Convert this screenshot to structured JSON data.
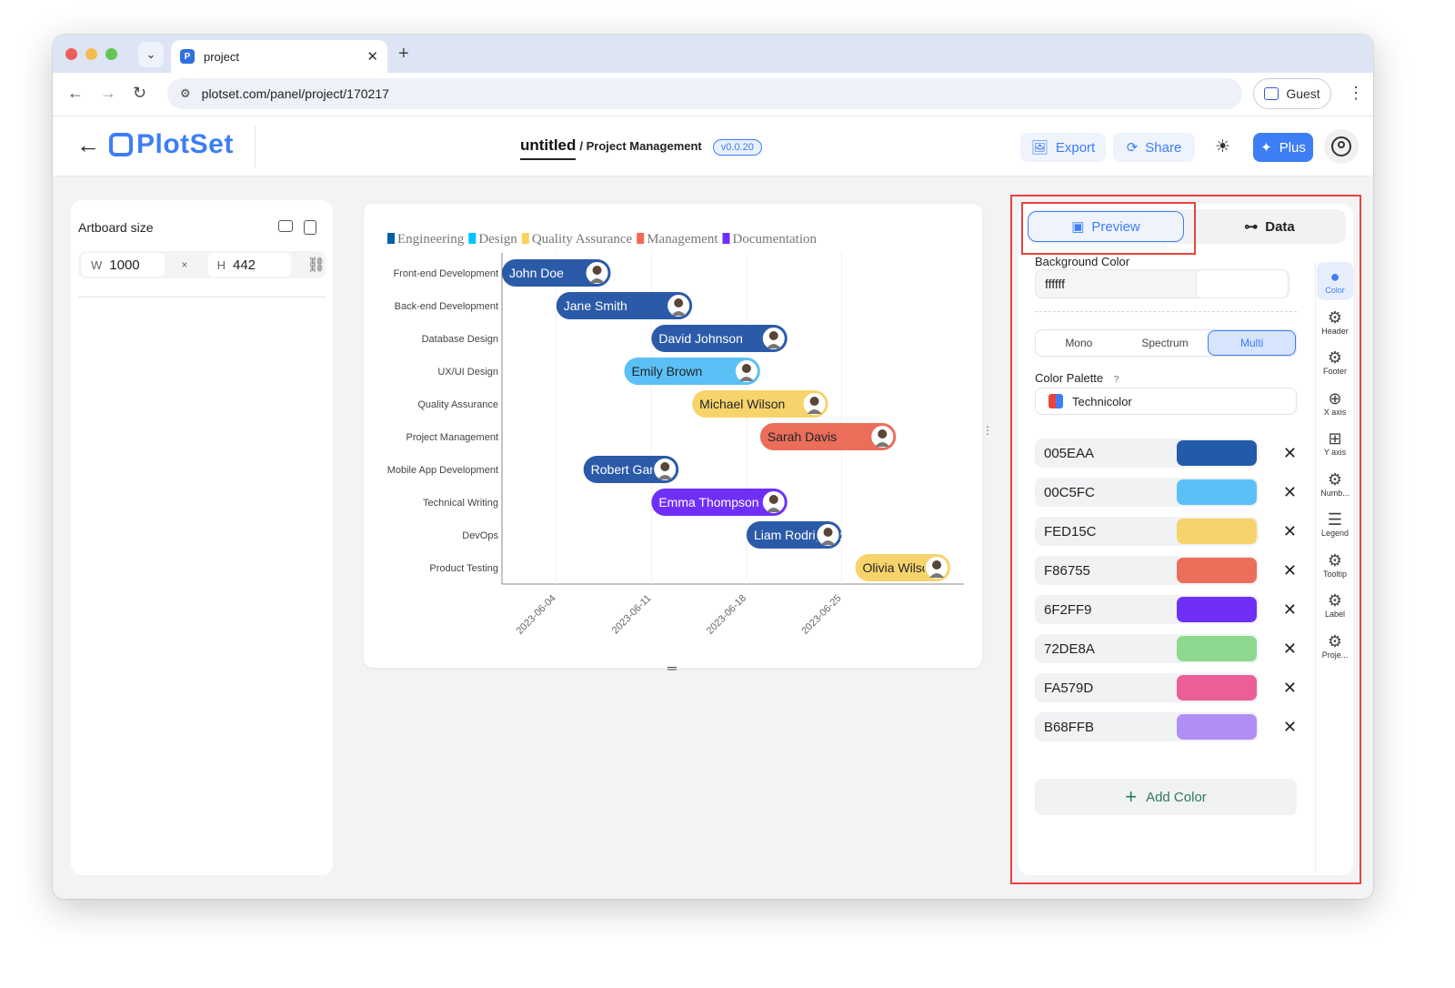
{
  "browser": {
    "tab_title": "project",
    "url": "plotset.com/panel/project/170217",
    "guest_label": "Guest"
  },
  "app": {
    "logo_text": "PlotSet",
    "project_name": "untitled",
    "project_sub": "/ Project Management",
    "version": "v0.0.20",
    "export_label": "Export",
    "share_label": "Share",
    "plus_label": "Plus"
  },
  "artboard": {
    "title": "Artboard size",
    "w_label": "W",
    "w_value": "1000",
    "times": "×",
    "h_label": "H",
    "h_value": "442"
  },
  "chart_data": {
    "type": "gantt",
    "legend": [
      {
        "name": "Engineering",
        "color": "#005EAA"
      },
      {
        "name": "Design",
        "color": "#00C5FC"
      },
      {
        "name": "Quality Assurance",
        "color": "#FED15C"
      },
      {
        "name": "Management",
        "color": "#F86755"
      },
      {
        "name": "Documentation",
        "color": "#6F2FF9"
      }
    ],
    "tasks": [
      {
        "task": "Front-end Development",
        "person": "John Doe",
        "start": "2023-05-31",
        "end": "2023-06-08",
        "color": "#2B5BA8",
        "text": "#ffffff"
      },
      {
        "task": "Back-end Development",
        "person": "Jane Smith",
        "start": "2023-06-04",
        "end": "2023-06-14",
        "color": "#2B5BA8",
        "text": "#ffffff"
      },
      {
        "task": "Database Design",
        "person": "David Johnson",
        "start": "2023-06-11",
        "end": "2023-06-21",
        "color": "#2B5BA8",
        "text": "#ffffff"
      },
      {
        "task": "UX/UI Design",
        "person": "Emily Brown",
        "start": "2023-06-09",
        "end": "2023-06-19",
        "color": "#5BC0F5",
        "text": "#1f2328"
      },
      {
        "task": "Quality Assurance",
        "person": "Michael Wilson",
        "start": "2023-06-14",
        "end": "2023-06-24",
        "color": "#F7D46B",
        "text": "#1f2328"
      },
      {
        "task": "Project Management",
        "person": "Sarah Davis",
        "start": "2023-06-19",
        "end": "2023-06-29",
        "color": "#EA6E5A",
        "text": "#1f2328"
      },
      {
        "task": "Mobile App Development",
        "person": "Robert Garcia",
        "start": "2023-06-06",
        "end": "2023-06-13",
        "color": "#2B5BA8",
        "text": "#ffffff"
      },
      {
        "task": "Technical Writing",
        "person": "Emma Thompson",
        "start": "2023-06-11",
        "end": "2023-06-21",
        "color": "#6F2FF9",
        "text": "#ffffff"
      },
      {
        "task": "DevOps",
        "person": "Liam Rodriguez",
        "start": "2023-06-18",
        "end": "2023-06-25",
        "color": "#2B5BA8",
        "text": "#ffffff"
      },
      {
        "task": "Product Testing",
        "person": "Olivia Wilson",
        "start": "2023-06-26",
        "end": "2023-07-03",
        "color": "#F7D46B",
        "text": "#1f2328"
      }
    ],
    "x_ticks": [
      "2023-06-04",
      "2023-06-11",
      "2023-06-18",
      "2023-06-25"
    ],
    "x_range": [
      "2023-05-31",
      "2023-07-04"
    ]
  },
  "panel": {
    "tab_preview": "Preview",
    "tab_data": "Data",
    "bg_label": "Background Color",
    "bg_value": "ffffff",
    "modes": [
      "Mono",
      "Spectrum",
      "Multi"
    ],
    "palette_label": "Color Palette",
    "palette_help": "?",
    "palette_value": "Technicolor",
    "colors": [
      {
        "code": "005EAA",
        "swatch": "#235BAA"
      },
      {
        "code": "00C5FC",
        "swatch": "#5BC0F5"
      },
      {
        "code": "FED15C",
        "swatch": "#F7D46B"
      },
      {
        "code": "F86755",
        "swatch": "#EA6E5A"
      },
      {
        "code": "6F2FF9",
        "swatch": "#6F2FF9"
      },
      {
        "code": "72DE8A",
        "swatch": "#8ED98F"
      },
      {
        "code": "FA579D",
        "swatch": "#EA5F97"
      },
      {
        "code": "B68FFB",
        "swatch": "#B08FF5"
      }
    ],
    "add_color": "Add Color",
    "sidebar": [
      "Color",
      "Header",
      "Footer",
      "X axis",
      "Y axis",
      "Numb...",
      "Legend",
      "Tooltip",
      "Label",
      "Proje..."
    ]
  }
}
